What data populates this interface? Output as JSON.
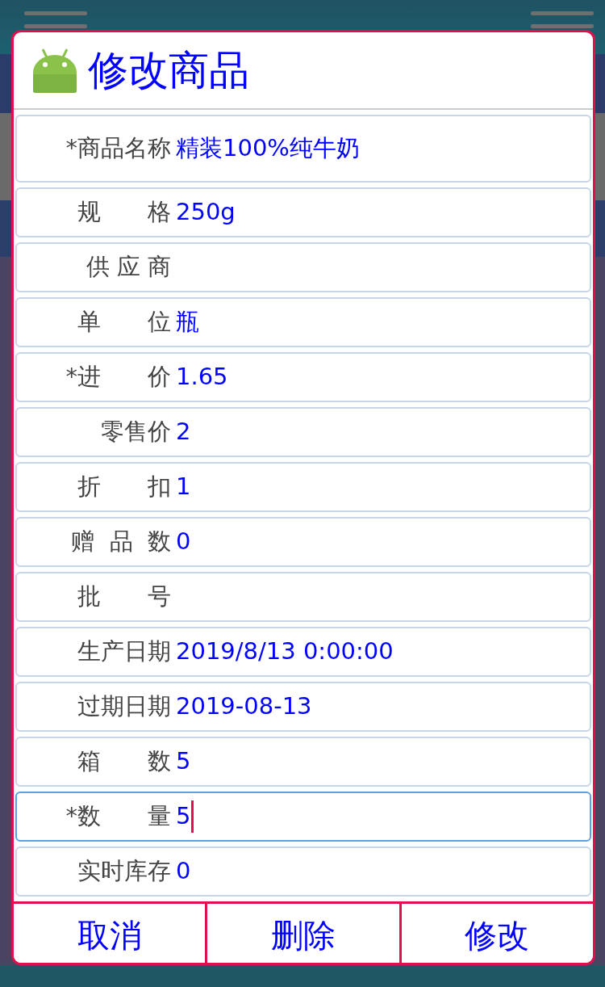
{
  "dialog": {
    "title": "修改商品",
    "fields": [
      {
        "label": "*商品名称",
        "value": "精装100%纯牛奶",
        "focused": false
      },
      {
        "label": "规　　格",
        "value": "250g",
        "focused": false
      },
      {
        "label": "供 应 商",
        "focused": false
      },
      {
        "label": "单　　位",
        "value": "瓶",
        "focused": false
      },
      {
        "label": "*进　　价",
        "value": "1.65",
        "focused": false
      },
      {
        "label": "零售价",
        "value": "2",
        "focused": false
      },
      {
        "label": "折　　扣",
        "value": "1",
        "focused": false
      },
      {
        "label": "赠  品  数",
        "value": "0",
        "focused": false
      },
      {
        "label": "批　　号",
        "focused": false
      },
      {
        "label": "生产日期",
        "value": "2019/8/13 0:00:00",
        "focused": false
      },
      {
        "label": "过期日期",
        "value": "2019-08-13",
        "focused": false
      },
      {
        "label": "箱　　数",
        "value": "5",
        "focused": false
      },
      {
        "label": "*数　　量",
        "value": "5",
        "focused": true
      },
      {
        "label": "实时库存",
        "value": "0",
        "focused": false
      }
    ],
    "buttons": [
      "取消",
      "删除",
      "修改"
    ]
  }
}
